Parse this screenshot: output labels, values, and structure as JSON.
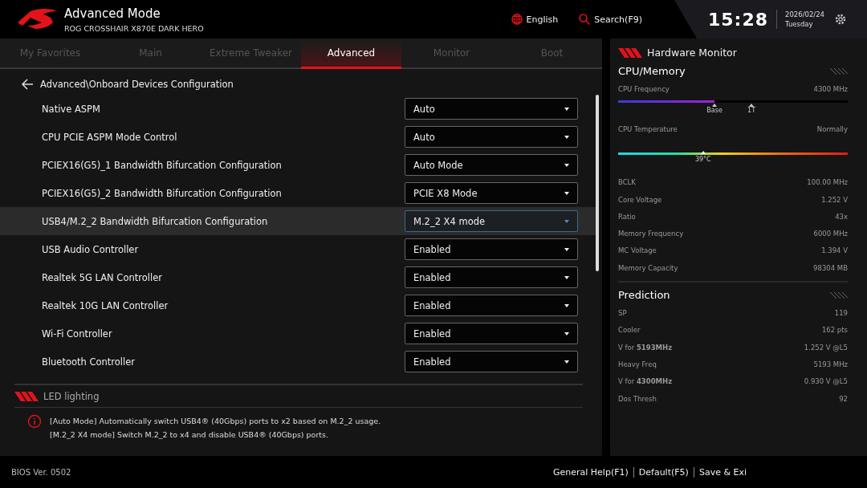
{
  "header": {
    "title": "Advanced Mode",
    "subtitle": "ROG CROSSHAIR X870E DARK HERO",
    "language": "English",
    "search": "Search(F9)",
    "time": "15:28",
    "date": "2026/02/24",
    "weekday": "Tuesday"
  },
  "tabs": [
    {
      "label": "My Favorites",
      "selected": false
    },
    {
      "label": "Main",
      "selected": false
    },
    {
      "label": "Extreme Tweaker",
      "selected": false
    },
    {
      "label": "Advanced",
      "selected": true
    },
    {
      "label": "Monitor",
      "selected": false
    },
    {
      "label": "Boot",
      "selected": false
    }
  ],
  "breadcrumb": "Advanced\\Onboard Devices Configuration",
  "settings": [
    {
      "label": "Native ASPM",
      "value": "Auto",
      "selected": false
    },
    {
      "label": "CPU PCIE ASPM Mode Control",
      "value": "Auto",
      "selected": false
    },
    {
      "label": "PCIEX16(G5)_1 Bandwidth Bifurcation Configuration",
      "value": "Auto Mode",
      "selected": false
    },
    {
      "label": "PCIEX16(G5)_2 Bandwidth Bifurcation Configuration",
      "value": "PCIE X8 Mode",
      "selected": false
    },
    {
      "label": "USB4/M.2_2 Bandwidth Bifurcation Configuration",
      "value": "M.2_2 X4 mode",
      "selected": true
    },
    {
      "label": "USB Audio Controller",
      "value": "Enabled",
      "selected": false
    },
    {
      "label": "Realtek 5G LAN Controller",
      "value": "Enabled",
      "selected": false
    },
    {
      "label": "Realtek 10G LAN Controller",
      "value": "Enabled",
      "selected": false
    },
    {
      "label": "Wi-Fi Controller",
      "value": "Enabled",
      "selected": false
    },
    {
      "label": "Bluetooth Controller",
      "value": "Enabled",
      "selected": false
    }
  ],
  "section": "LED lighting",
  "help": [
    "[Auto Mode] Automatically switch USB4® (40Gbps) ports to x2 based on M.2_2 usage.",
    "[M.2_2 X4 mode] Switch M.2_2 to x4 and disable USB4® (40Gbps) ports."
  ],
  "hardware_monitor": {
    "title": "Hardware Monitor",
    "cpu_memory": {
      "title": "CPU/Memory",
      "frequency": {
        "label": "CPU Frequency",
        "reading": "4300 MHz",
        "level": 0.42,
        "ticks": [
          "Base",
          "1T"
        ]
      },
      "temperature": {
        "label": "CPU Temperature",
        "reading": "Normally",
        "marker": "39°C",
        "level": 0.37
      },
      "rows": [
        {
          "label": "BCLK",
          "value": "100.00 MHz"
        },
        {
          "label": "Core Voltage",
          "value": "1.252 V"
        },
        {
          "label": "Ratio",
          "value": "43x"
        },
        {
          "label": "Memory Frequency",
          "value": "6000 MHz"
        },
        {
          "label": "MC Voltage",
          "value": "1.394 V"
        },
        {
          "label": "Memory Capacity",
          "value": "98304 MB"
        }
      ]
    },
    "prediction": {
      "title": "Prediction",
      "rows": [
        {
          "label": "SP",
          "value": "119"
        },
        {
          "label": "Cooler",
          "value": "162 pts"
        },
        {
          "label": "V for **5193MHz**",
          "value": "1.252 V @L5"
        },
        {
          "label": "Heavy Freq",
          "value": "5193 MHz"
        },
        {
          "label": "V for **4300MHz**",
          "value": "0.930 V @L5"
        },
        {
          "label": "Dos Thresh",
          "value": "92"
        }
      ]
    }
  },
  "footer": {
    "version": "BIOS Ver. 0502",
    "keys": [
      "General Help(F1)",
      "Default(F5)",
      "Save & Exi"
    ]
  }
}
